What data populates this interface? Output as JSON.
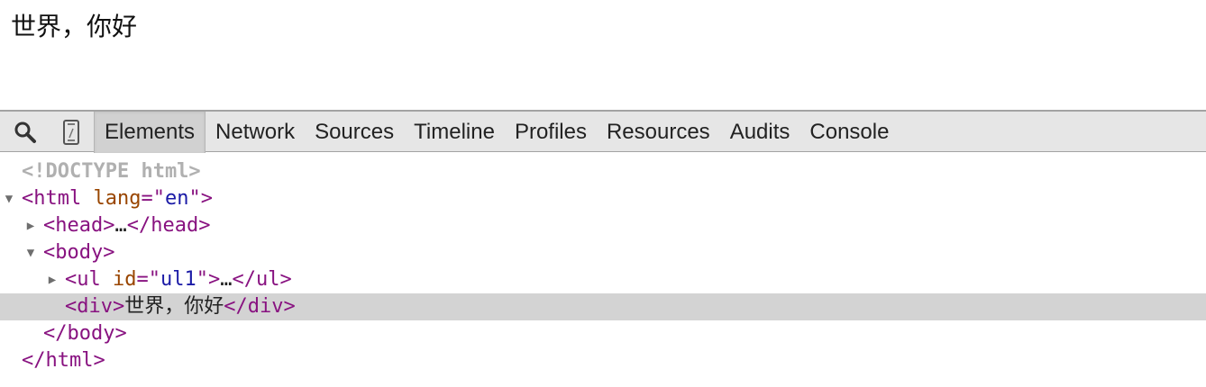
{
  "page": {
    "content_text": "世界，你好"
  },
  "toolbar": {
    "icons": {
      "search": "search-icon",
      "device": "device-mode-icon"
    },
    "tabs": [
      {
        "label": "Elements",
        "selected": true
      },
      {
        "label": "Network",
        "selected": false
      },
      {
        "label": "Sources",
        "selected": false
      },
      {
        "label": "Timeline",
        "selected": false
      },
      {
        "label": "Profiles",
        "selected": false
      },
      {
        "label": "Resources",
        "selected": false
      },
      {
        "label": "Audits",
        "selected": false
      },
      {
        "label": "Console",
        "selected": false
      }
    ]
  },
  "dom_tree": {
    "doctype": "<!DOCTYPE html>",
    "html_open": "<html",
    "html_attr_name": "lang",
    "html_attr_eq": "=\"",
    "html_attr_value": "en",
    "html_attr_close": "\">",
    "head_open": "<head>",
    "head_ellipsis": "…",
    "head_close": "</head>",
    "body_open": "<body>",
    "ul_open": "<ul",
    "ul_attr_name": "id",
    "ul_attr_eq": "=\"",
    "ul_attr_value": "ul1",
    "ul_attr_close": "\">",
    "ul_ellipsis": "…",
    "ul_close": "</ul>",
    "div_open": "<div>",
    "div_text": "世界，你好",
    "div_close": "</div>",
    "body_close": "</body>",
    "html_close": "</html>",
    "expanded_glyph": "▼",
    "collapsed_glyph": "▶"
  },
  "colors": {
    "tag": "#881280",
    "attr_name": "#994500",
    "attr_value": "#1a1aa6",
    "doctype": "#b0b0b0",
    "selected_row": "#d3d3d3",
    "toolbar_bg": "#e6e6e6"
  }
}
